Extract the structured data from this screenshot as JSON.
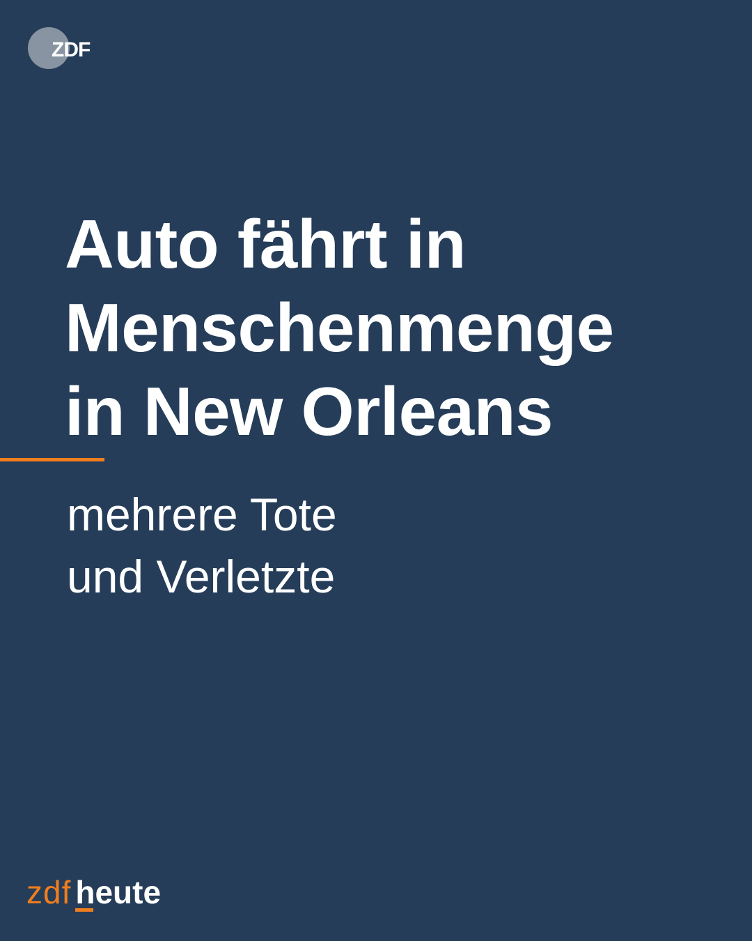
{
  "logo": {
    "name": "ZDF",
    "icon": "zdf-logo-icon",
    "color": "#9aa3ae"
  },
  "headline": {
    "lines": [
      "Auto fährt in",
      "Menschenmenge",
      "in New Orleans"
    ]
  },
  "subline": {
    "lines": [
      "mehrere Tote",
      "und Verletzte"
    ]
  },
  "brand": {
    "prefix": "zdf",
    "suffix": "heute",
    "accent_color": "#f07d1e"
  },
  "colors": {
    "background": "#253d59",
    "text": "#ffffff",
    "accent": "#f07d1e"
  }
}
